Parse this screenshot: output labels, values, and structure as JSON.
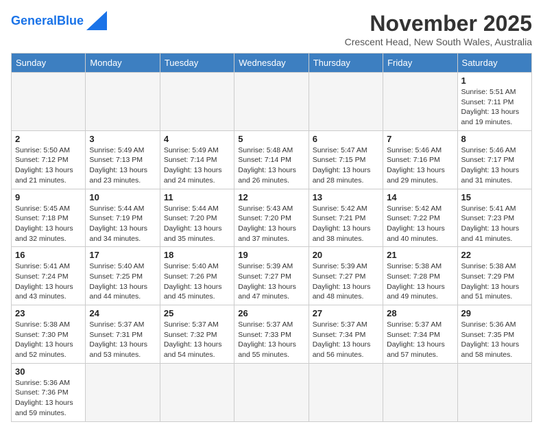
{
  "header": {
    "logo_general": "General",
    "logo_blue": "Blue",
    "month_title": "November 2025",
    "subtitle": "Crescent Head, New South Wales, Australia"
  },
  "days_of_week": [
    "Sunday",
    "Monday",
    "Tuesday",
    "Wednesday",
    "Thursday",
    "Friday",
    "Saturday"
  ],
  "weeks": [
    [
      {
        "day": "",
        "info": ""
      },
      {
        "day": "",
        "info": ""
      },
      {
        "day": "",
        "info": ""
      },
      {
        "day": "",
        "info": ""
      },
      {
        "day": "",
        "info": ""
      },
      {
        "day": "",
        "info": ""
      },
      {
        "day": "1",
        "info": "Sunrise: 5:51 AM\nSunset: 7:11 PM\nDaylight: 13 hours\nand 19 minutes."
      }
    ],
    [
      {
        "day": "2",
        "info": "Sunrise: 5:50 AM\nSunset: 7:12 PM\nDaylight: 13 hours\nand 21 minutes."
      },
      {
        "day": "3",
        "info": "Sunrise: 5:49 AM\nSunset: 7:13 PM\nDaylight: 13 hours\nand 23 minutes."
      },
      {
        "day": "4",
        "info": "Sunrise: 5:49 AM\nSunset: 7:14 PM\nDaylight: 13 hours\nand 24 minutes."
      },
      {
        "day": "5",
        "info": "Sunrise: 5:48 AM\nSunset: 7:14 PM\nDaylight: 13 hours\nand 26 minutes."
      },
      {
        "day": "6",
        "info": "Sunrise: 5:47 AM\nSunset: 7:15 PM\nDaylight: 13 hours\nand 28 minutes."
      },
      {
        "day": "7",
        "info": "Sunrise: 5:46 AM\nSunset: 7:16 PM\nDaylight: 13 hours\nand 29 minutes."
      },
      {
        "day": "8",
        "info": "Sunrise: 5:46 AM\nSunset: 7:17 PM\nDaylight: 13 hours\nand 31 minutes."
      }
    ],
    [
      {
        "day": "9",
        "info": "Sunrise: 5:45 AM\nSunset: 7:18 PM\nDaylight: 13 hours\nand 32 minutes."
      },
      {
        "day": "10",
        "info": "Sunrise: 5:44 AM\nSunset: 7:19 PM\nDaylight: 13 hours\nand 34 minutes."
      },
      {
        "day": "11",
        "info": "Sunrise: 5:44 AM\nSunset: 7:20 PM\nDaylight: 13 hours\nand 35 minutes."
      },
      {
        "day": "12",
        "info": "Sunrise: 5:43 AM\nSunset: 7:20 PM\nDaylight: 13 hours\nand 37 minutes."
      },
      {
        "day": "13",
        "info": "Sunrise: 5:42 AM\nSunset: 7:21 PM\nDaylight: 13 hours\nand 38 minutes."
      },
      {
        "day": "14",
        "info": "Sunrise: 5:42 AM\nSunset: 7:22 PM\nDaylight: 13 hours\nand 40 minutes."
      },
      {
        "day": "15",
        "info": "Sunrise: 5:41 AM\nSunset: 7:23 PM\nDaylight: 13 hours\nand 41 minutes."
      }
    ],
    [
      {
        "day": "16",
        "info": "Sunrise: 5:41 AM\nSunset: 7:24 PM\nDaylight: 13 hours\nand 43 minutes."
      },
      {
        "day": "17",
        "info": "Sunrise: 5:40 AM\nSunset: 7:25 PM\nDaylight: 13 hours\nand 44 minutes."
      },
      {
        "day": "18",
        "info": "Sunrise: 5:40 AM\nSunset: 7:26 PM\nDaylight: 13 hours\nand 45 minutes."
      },
      {
        "day": "19",
        "info": "Sunrise: 5:39 AM\nSunset: 7:27 PM\nDaylight: 13 hours\nand 47 minutes."
      },
      {
        "day": "20",
        "info": "Sunrise: 5:39 AM\nSunset: 7:27 PM\nDaylight: 13 hours\nand 48 minutes."
      },
      {
        "day": "21",
        "info": "Sunrise: 5:38 AM\nSunset: 7:28 PM\nDaylight: 13 hours\nand 49 minutes."
      },
      {
        "day": "22",
        "info": "Sunrise: 5:38 AM\nSunset: 7:29 PM\nDaylight: 13 hours\nand 51 minutes."
      }
    ],
    [
      {
        "day": "23",
        "info": "Sunrise: 5:38 AM\nSunset: 7:30 PM\nDaylight: 13 hours\nand 52 minutes."
      },
      {
        "day": "24",
        "info": "Sunrise: 5:37 AM\nSunset: 7:31 PM\nDaylight: 13 hours\nand 53 minutes."
      },
      {
        "day": "25",
        "info": "Sunrise: 5:37 AM\nSunset: 7:32 PM\nDaylight: 13 hours\nand 54 minutes."
      },
      {
        "day": "26",
        "info": "Sunrise: 5:37 AM\nSunset: 7:33 PM\nDaylight: 13 hours\nand 55 minutes."
      },
      {
        "day": "27",
        "info": "Sunrise: 5:37 AM\nSunset: 7:34 PM\nDaylight: 13 hours\nand 56 minutes."
      },
      {
        "day": "28",
        "info": "Sunrise: 5:37 AM\nSunset: 7:34 PM\nDaylight: 13 hours\nand 57 minutes."
      },
      {
        "day": "29",
        "info": "Sunrise: 5:36 AM\nSunset: 7:35 PM\nDaylight: 13 hours\nand 58 minutes."
      }
    ],
    [
      {
        "day": "30",
        "info": "Sunrise: 5:36 AM\nSunset: 7:36 PM\nDaylight: 13 hours\nand 59 minutes."
      },
      {
        "day": "",
        "info": ""
      },
      {
        "day": "",
        "info": ""
      },
      {
        "day": "",
        "info": ""
      },
      {
        "day": "",
        "info": ""
      },
      {
        "day": "",
        "info": ""
      },
      {
        "day": "",
        "info": ""
      }
    ]
  ]
}
